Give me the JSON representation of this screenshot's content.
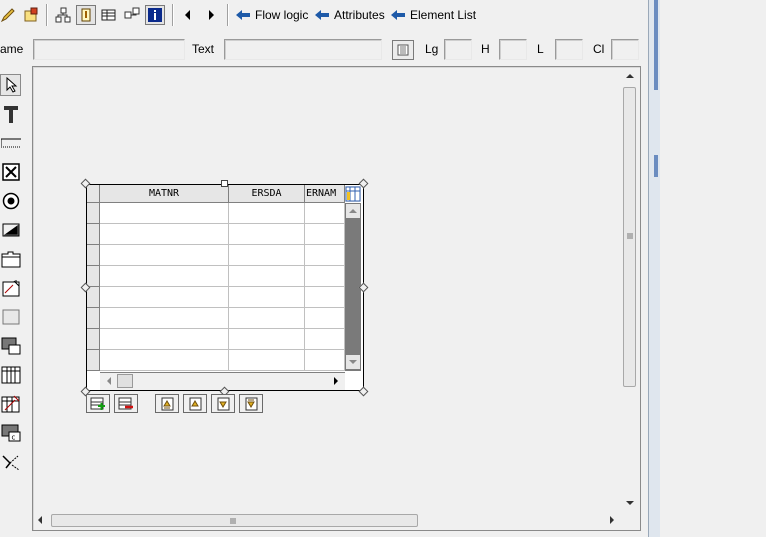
{
  "toolbar": {
    "icons": [
      "pencil-icon",
      "layout-icon",
      "hierarchy-icon",
      "info-field-icon",
      "table-icon",
      "move-icon",
      "info-icon"
    ],
    "nav_prev": "previous-arrow-icon",
    "nav_next": "next-arrow-icon",
    "flow_logic": "Flow logic",
    "attributes": "Attributes",
    "element_list": "Element List"
  },
  "attr_row": {
    "name_label": "ame",
    "name_value": "",
    "text_label": "Text",
    "text_value": "",
    "lg_label": "Lg",
    "lg_value": "",
    "h_label": "H",
    "h_value": "",
    "l_label": "L",
    "l_value": "",
    "cl_label": "Cl",
    "cl_value": ""
  },
  "palette": [
    "pointer",
    "text",
    "input-field",
    "checkbox",
    "radio-button",
    "pushbutton",
    "tabstrip",
    "subscreen-wizard",
    "box",
    "subscreen",
    "table-control",
    "table-control-wizard",
    "custom-control",
    "status-icon"
  ],
  "table_control": {
    "columns": [
      "MATNR",
      "ERSDA",
      "ERNAM"
    ],
    "rows": 8
  },
  "table_buttons": [
    "insert-row",
    "delete-row",
    "first-page",
    "prev-page",
    "next-page",
    "last-page"
  ],
  "colors": {
    "background": "#f0f0f0",
    "arrow_blue": "#1e5aa8",
    "info_blue": "#0a2a8c",
    "scroll_dark": "#7a7a7a"
  }
}
